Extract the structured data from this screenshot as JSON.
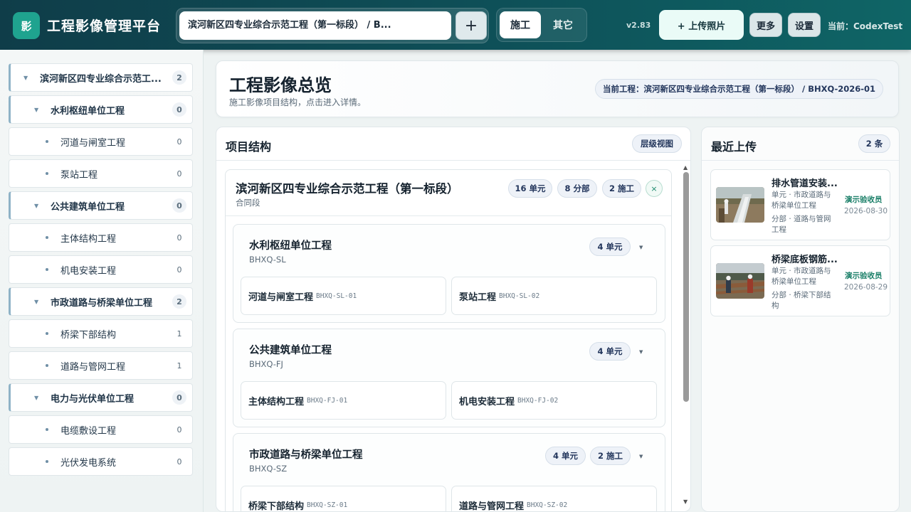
{
  "header": {
    "logo_text": "影",
    "app_title": "工程影像管理平台",
    "project_select": "滨河新区四专业综合示范工程（第一标段） / B...",
    "add_project": "+",
    "tabs": [
      {
        "label": "施工"
      },
      {
        "label": "其它"
      }
    ],
    "version": "v2.83",
    "upload_label": "+ 上传照片",
    "more_label": "更多",
    "settings_label": "设置",
    "user_label": "当前：CodexTest"
  },
  "sidebar": {
    "items": [
      {
        "label": "滨河新区四专业综合示范工...",
        "count": "2",
        "level": 0
      },
      {
        "label": "水利枢纽单位工程",
        "count": "0",
        "level": 1
      },
      {
        "label": "河道与闸室工程",
        "count": "0",
        "level": 2
      },
      {
        "label": "泵站工程",
        "count": "0",
        "level": 2
      },
      {
        "label": "公共建筑单位工程",
        "count": "0",
        "level": 1
      },
      {
        "label": "主体结构工程",
        "count": "0",
        "level": 2
      },
      {
        "label": "机电安装工程",
        "count": "0",
        "level": 2
      },
      {
        "label": "市政道路与桥梁单位工程",
        "count": "2",
        "level": 1
      },
      {
        "label": "桥梁下部结构",
        "count": "1",
        "level": 2
      },
      {
        "label": "道路与管网工程",
        "count": "1",
        "level": 2
      },
      {
        "label": "电力与光伏单位工程",
        "count": "0",
        "level": 1
      },
      {
        "label": "电缆敷设工程",
        "count": "0",
        "level": 2
      },
      {
        "label": "光伏发电系统",
        "count": "0",
        "level": 2
      }
    ]
  },
  "overview": {
    "title": "工程影像总览",
    "subtitle": "施工影像项目结构，点击进入详情。",
    "current_project": "当前工程：滨河新区四专业综合示范工程（第一标段） / BHXQ-2026-01"
  },
  "structure": {
    "title": "项目结构",
    "view_label": "层级视图",
    "contract": {
      "name": "滨河新区四专业综合示范工程（第一标段）",
      "type": "合同段",
      "badges": [
        "16 单元",
        "8 分部",
        "2 施工"
      ],
      "close": "×"
    },
    "units": [
      {
        "name": "水利枢纽单位工程",
        "code": "BHXQ-SL",
        "badges": [
          "4 单元"
        ],
        "subs": [
          {
            "name": "河道与闸室工程",
            "code": "BHXQ-SL-01"
          },
          {
            "name": "泵站工程",
            "code": "BHXQ-SL-02"
          }
        ]
      },
      {
        "name": "公共建筑单位工程",
        "code": "BHXQ-FJ",
        "badges": [
          "4 单元"
        ],
        "subs": [
          {
            "name": "主体结构工程",
            "code": "BHXQ-FJ-01"
          },
          {
            "name": "机电安装工程",
            "code": "BHXQ-FJ-02"
          }
        ]
      },
      {
        "name": "市政道路与桥梁单位工程",
        "code": "BHXQ-SZ",
        "badges": [
          "4 单元",
          "2 施工"
        ],
        "subs": [
          {
            "name": "桥梁下部结构",
            "code": "BHXQ-SZ-01"
          },
          {
            "name": "道路与管网工程",
            "code": "BHXQ-SZ-02"
          }
        ]
      }
    ]
  },
  "recent": {
    "title": "最近上传",
    "count_label": "2 条",
    "items": [
      {
        "title": "排水管道安装...",
        "unit": "单元 · 市政道路与桥梁单位工程",
        "section": "分部 · 道路与管网工程",
        "user": "演示验收员",
        "date": "2026-08-30"
      },
      {
        "title": "桥梁底板钢筋...",
        "unit": "单元 · 市政道路与桥梁单位工程",
        "section": "分部 · 桥梁下部结构",
        "user": "演示验收员",
        "date": "2026-08-29"
      }
    ]
  },
  "colors": {
    "header": "#0e5058",
    "accent": "#1fa38f",
    "badge_text": "#23365c",
    "user_green": "#1a7f68"
  }
}
